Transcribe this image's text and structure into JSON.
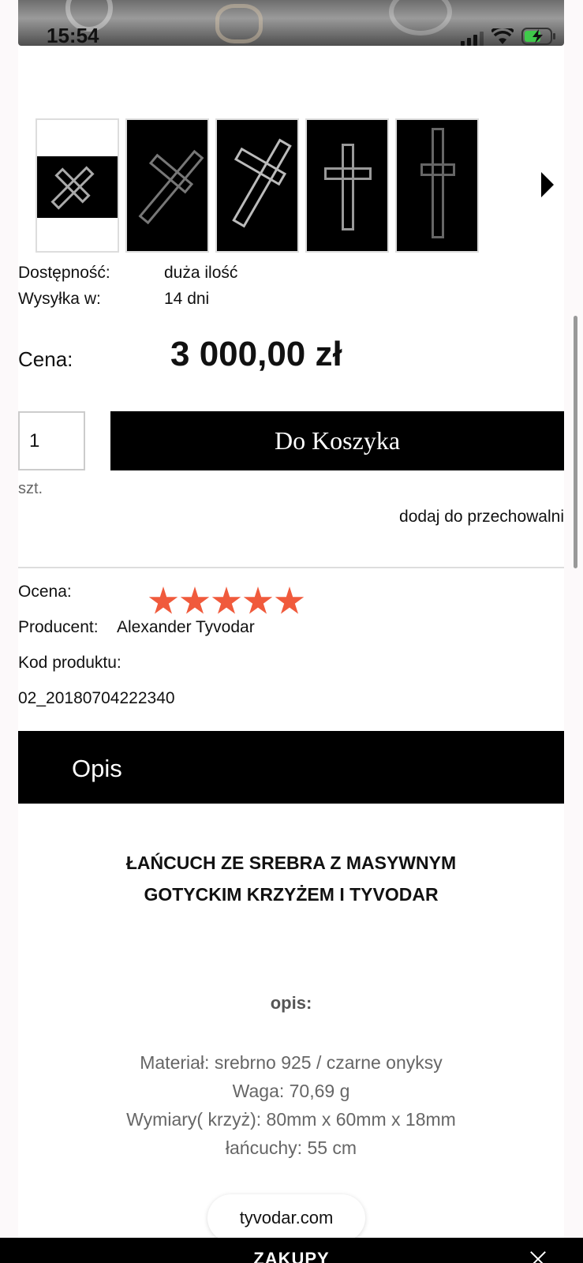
{
  "status": {
    "time": "15:54"
  },
  "product": {
    "availability_label": "Dostępność:",
    "availability_value": "duża ilość",
    "shipping_label": "Wysyłka w:",
    "shipping_value": "14 dni",
    "price_label": "Cena:",
    "price_value": "3 000,00 zł",
    "quantity": "1",
    "add_to_cart": "Do Koszyka",
    "unit": "szt.",
    "store_link": "dodaj do przechowalni",
    "rating_label": "Ocena:",
    "rating_stars": 5,
    "producer_label": "Producent:",
    "producer_value": "Alexander Tyvodar",
    "code_label": "Kod produktu:",
    "code_value": "02_20180704222340"
  },
  "description": {
    "tab_label": "Opis",
    "title_line1": "ŁAŃCUCH ZE SREBRA Z MASYWNYM",
    "title_line2": "GOTYCKIM KRZYŻEM I TYVODAR",
    "section_label": "opis:",
    "specs": [
      "Materiał: srebrno 925 / czarne onyksy",
      "Waga: 70,69 g",
      "Wymiary( krzyż): 80mm x 60mm x 18mm",
      "łańcuchy: 55 cm"
    ]
  },
  "browser": {
    "url": "tyvodar.com",
    "bottom_label": "ZAKUPY"
  },
  "colors": {
    "star": "#f05a3c",
    "button_bg": "#000000"
  },
  "icons": [
    "signal-icon",
    "wifi-icon",
    "battery-charging-icon",
    "chevron-right-icon",
    "star-icon",
    "close-icon"
  ]
}
